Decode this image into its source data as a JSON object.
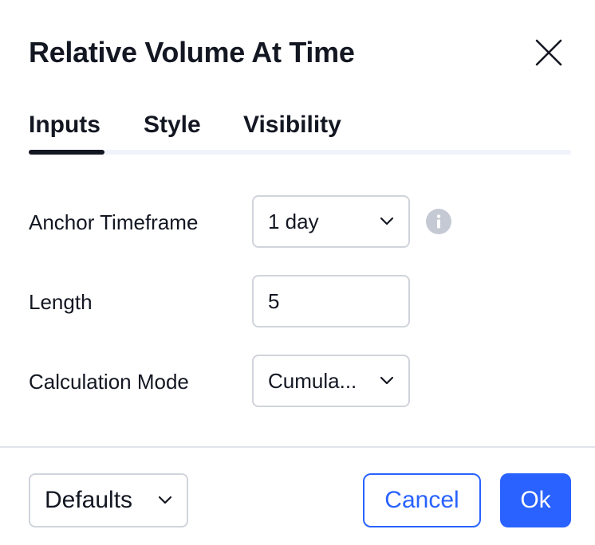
{
  "dialog": {
    "title": "Relative Volume At Time"
  },
  "tabs": [
    {
      "label": "Inputs",
      "active": true
    },
    {
      "label": "Style",
      "active": false
    },
    {
      "label": "Visibility",
      "active": false
    }
  ],
  "inputs": {
    "anchor_timeframe": {
      "label": "Anchor Timeframe",
      "value": "1 day"
    },
    "length": {
      "label": "Length",
      "value": "5"
    },
    "calculation_mode": {
      "label": "Calculation Mode",
      "value": "Cumula..."
    }
  },
  "footer": {
    "defaults_label": "Defaults",
    "cancel_label": "Cancel",
    "ok_label": "Ok"
  },
  "colors": {
    "accent": "#2962ff",
    "text": "#131722",
    "border": "#d1d4dc",
    "info_icon": "#c5c9d3"
  },
  "icons": {
    "close": "close-icon",
    "chevron": "chevron-down-icon",
    "info": "info-icon"
  }
}
